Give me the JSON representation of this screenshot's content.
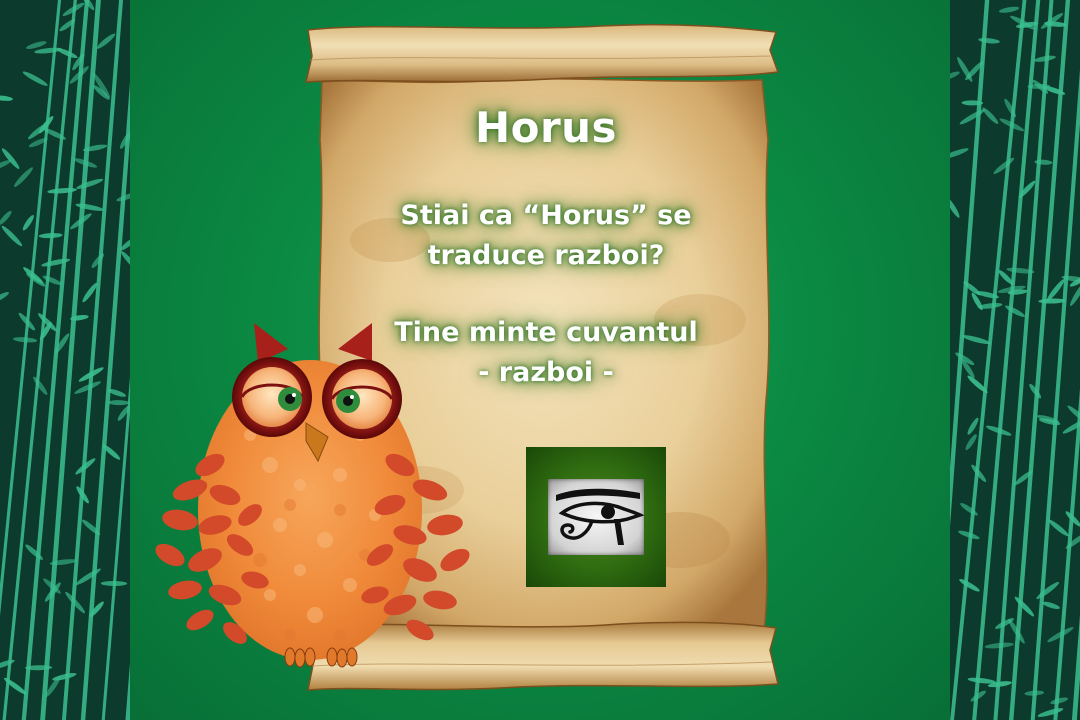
{
  "slide": {
    "title": "Horus",
    "question_lines": [
      "Stiai ca “Horus” se",
      "traduce razboi?"
    ],
    "remember_lines": [
      "Tine minte cuvantul",
      "- razboi -"
    ]
  },
  "colors": {
    "background_green": "#0b8a43",
    "side_panel": "#0c3a2c",
    "bamboo": "#3bbf8f",
    "parchment": "#e9cf9a",
    "owl_orange": "#f08a3a",
    "owl_leaf_red": "#d24a2a",
    "eye_frame_green": "#2e6a10"
  },
  "icons": {
    "eye_symbol": "eye-of-horus-icon",
    "mascot": "owl-mascot"
  }
}
